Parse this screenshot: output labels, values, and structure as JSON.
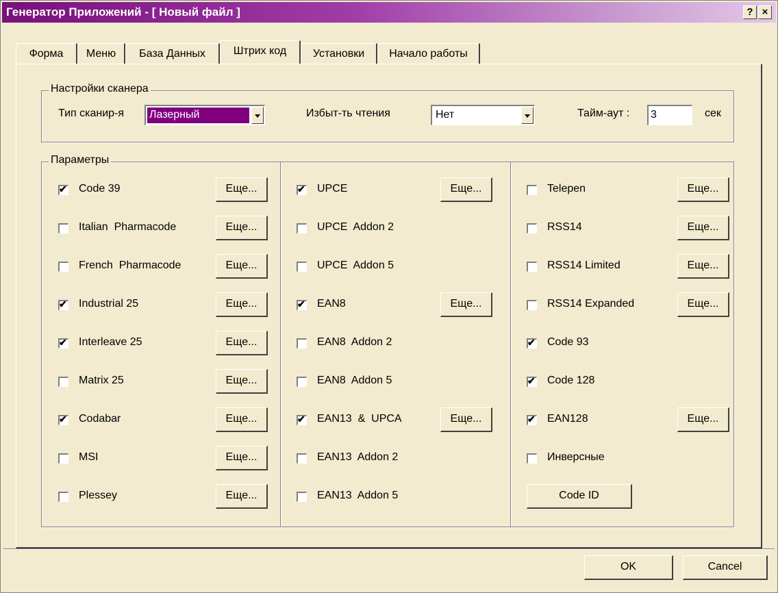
{
  "window": {
    "title": "Генератор Приложений - [ Новый файл ]",
    "help_glyph": "?",
    "close_glyph": "×"
  },
  "tabs": [
    {
      "label": "Форма"
    },
    {
      "label": "Меню"
    },
    {
      "label": "База Данных"
    },
    {
      "label": "Штрих код",
      "active": true
    },
    {
      "label": "Установки"
    },
    {
      "label": "Начало работы"
    }
  ],
  "scanner": {
    "legend": "Настройки сканера",
    "type_label": "Тип сканир-я",
    "type_value": "Лазерный",
    "redundancy_label": "Избыт-ть чтения",
    "redundancy_value": "Нет",
    "timeout_label": "Тайм-аут :",
    "timeout_value": "3",
    "timeout_unit": "сек"
  },
  "params": {
    "legend": "Параметры",
    "more_label": "Еще...",
    "code_id_label": "Code ID",
    "col1": [
      {
        "label": "Code 39",
        "checked": true,
        "more": true
      },
      {
        "label": "Italian  Pharmacode",
        "checked": false,
        "more": true
      },
      {
        "label": "French  Pharmacode",
        "checked": false,
        "more": true
      },
      {
        "label": "Industrial 25",
        "checked": true,
        "more": true
      },
      {
        "label": "Interleave 25",
        "checked": true,
        "more": true
      },
      {
        "label": "Matrix 25",
        "checked": false,
        "more": true
      },
      {
        "label": "Codabar",
        "checked": true,
        "more": true
      },
      {
        "label": "MSI",
        "checked": false,
        "more": true
      },
      {
        "label": "Plessey",
        "checked": false,
        "more": true
      }
    ],
    "col2": [
      {
        "label": "UPCE",
        "checked": true,
        "more": true
      },
      {
        "label": "UPCE  Addon 2",
        "checked": false,
        "more": false
      },
      {
        "label": "UPCE  Addon 5",
        "checked": false,
        "more": false
      },
      {
        "label": "EAN8",
        "checked": true,
        "more": true
      },
      {
        "label": "EAN8  Addon 2",
        "checked": false,
        "more": false
      },
      {
        "label": "EAN8  Addon 5",
        "checked": false,
        "more": false
      },
      {
        "label": "EAN13  &  UPCA",
        "checked": true,
        "more": true
      },
      {
        "label": "EAN13  Addon 2",
        "checked": false,
        "more": false
      },
      {
        "label": "EAN13  Addon 5",
        "checked": false,
        "more": false
      }
    ],
    "col3": [
      {
        "label": "Telepen",
        "checked": false,
        "more": true
      },
      {
        "label": "RSS14",
        "checked": false,
        "more": true
      },
      {
        "label": "RSS14 Limited",
        "checked": false,
        "more": true
      },
      {
        "label": "RSS14 Expanded",
        "checked": false,
        "more": true
      },
      {
        "label": "Code 93",
        "checked": true,
        "more": false
      },
      {
        "label": "Code 128",
        "checked": true,
        "more": false
      },
      {
        "label": "EAN128",
        "checked": true,
        "more": true
      },
      {
        "label": "Инверсные",
        "checked": false,
        "more": false
      }
    ]
  },
  "footer": {
    "ok_label": "OK",
    "cancel_label": "Cancel"
  },
  "colors": {
    "title_gradient_start": "#78107A",
    "selection": "#800080",
    "face": "#F2EBCF"
  }
}
